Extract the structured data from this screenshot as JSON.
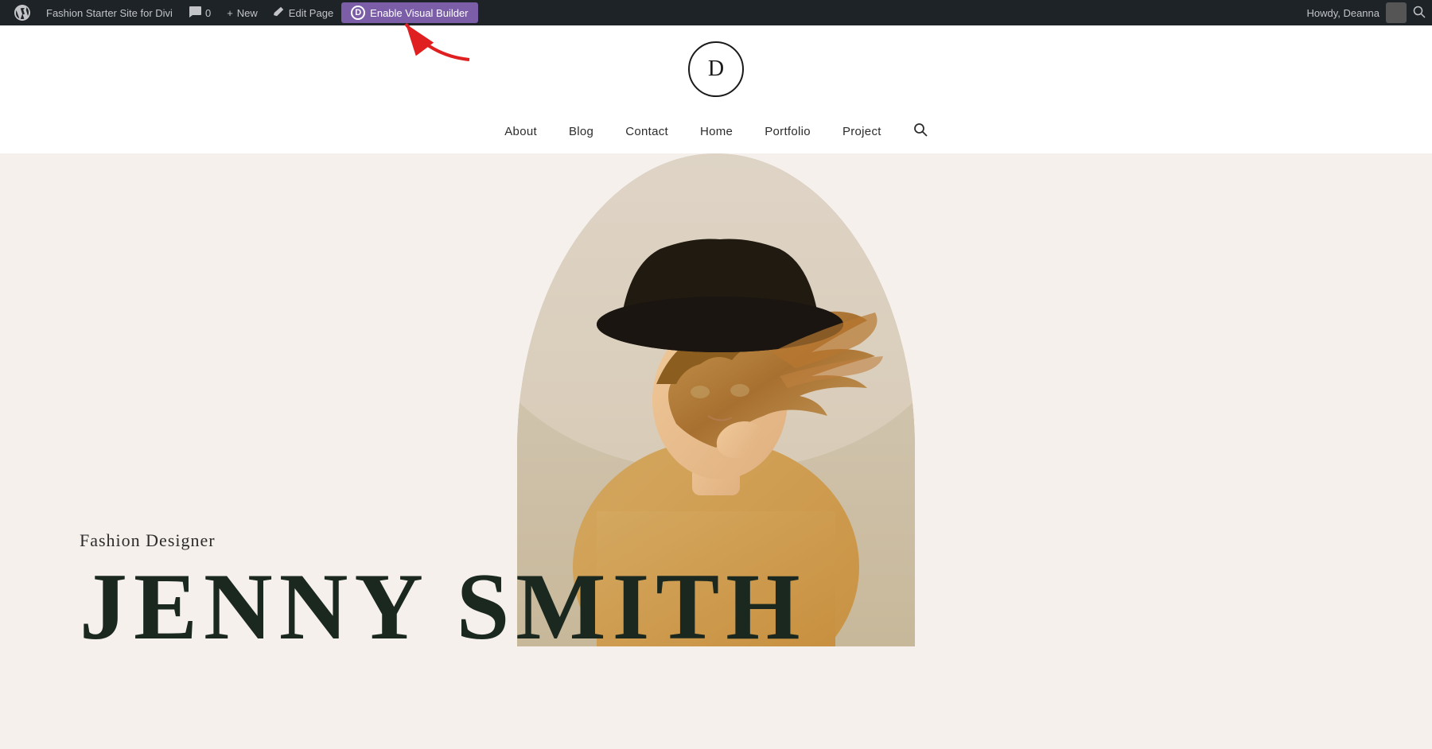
{
  "adminBar": {
    "siteTitle": "Fashion Starter Site for Divi",
    "commentCount": "0",
    "newLabel": "New",
    "editPageLabel": "Edit Page",
    "enableVisualBuilderLabel": "Enable Visual Builder",
    "diviLetter": "D",
    "howdyText": "Howdy, Deanna"
  },
  "site": {
    "logoLetter": "D"
  },
  "nav": {
    "items": [
      {
        "label": "About",
        "href": "#"
      },
      {
        "label": "Blog",
        "href": "#"
      },
      {
        "label": "Contact",
        "href": "#"
      },
      {
        "label": "Home",
        "href": "#"
      },
      {
        "label": "Portfolio",
        "href": "#"
      },
      {
        "label": "Project",
        "href": "#"
      }
    ]
  },
  "hero": {
    "subtitle": "Fashion Designer",
    "name": "JENNY SMITH"
  }
}
